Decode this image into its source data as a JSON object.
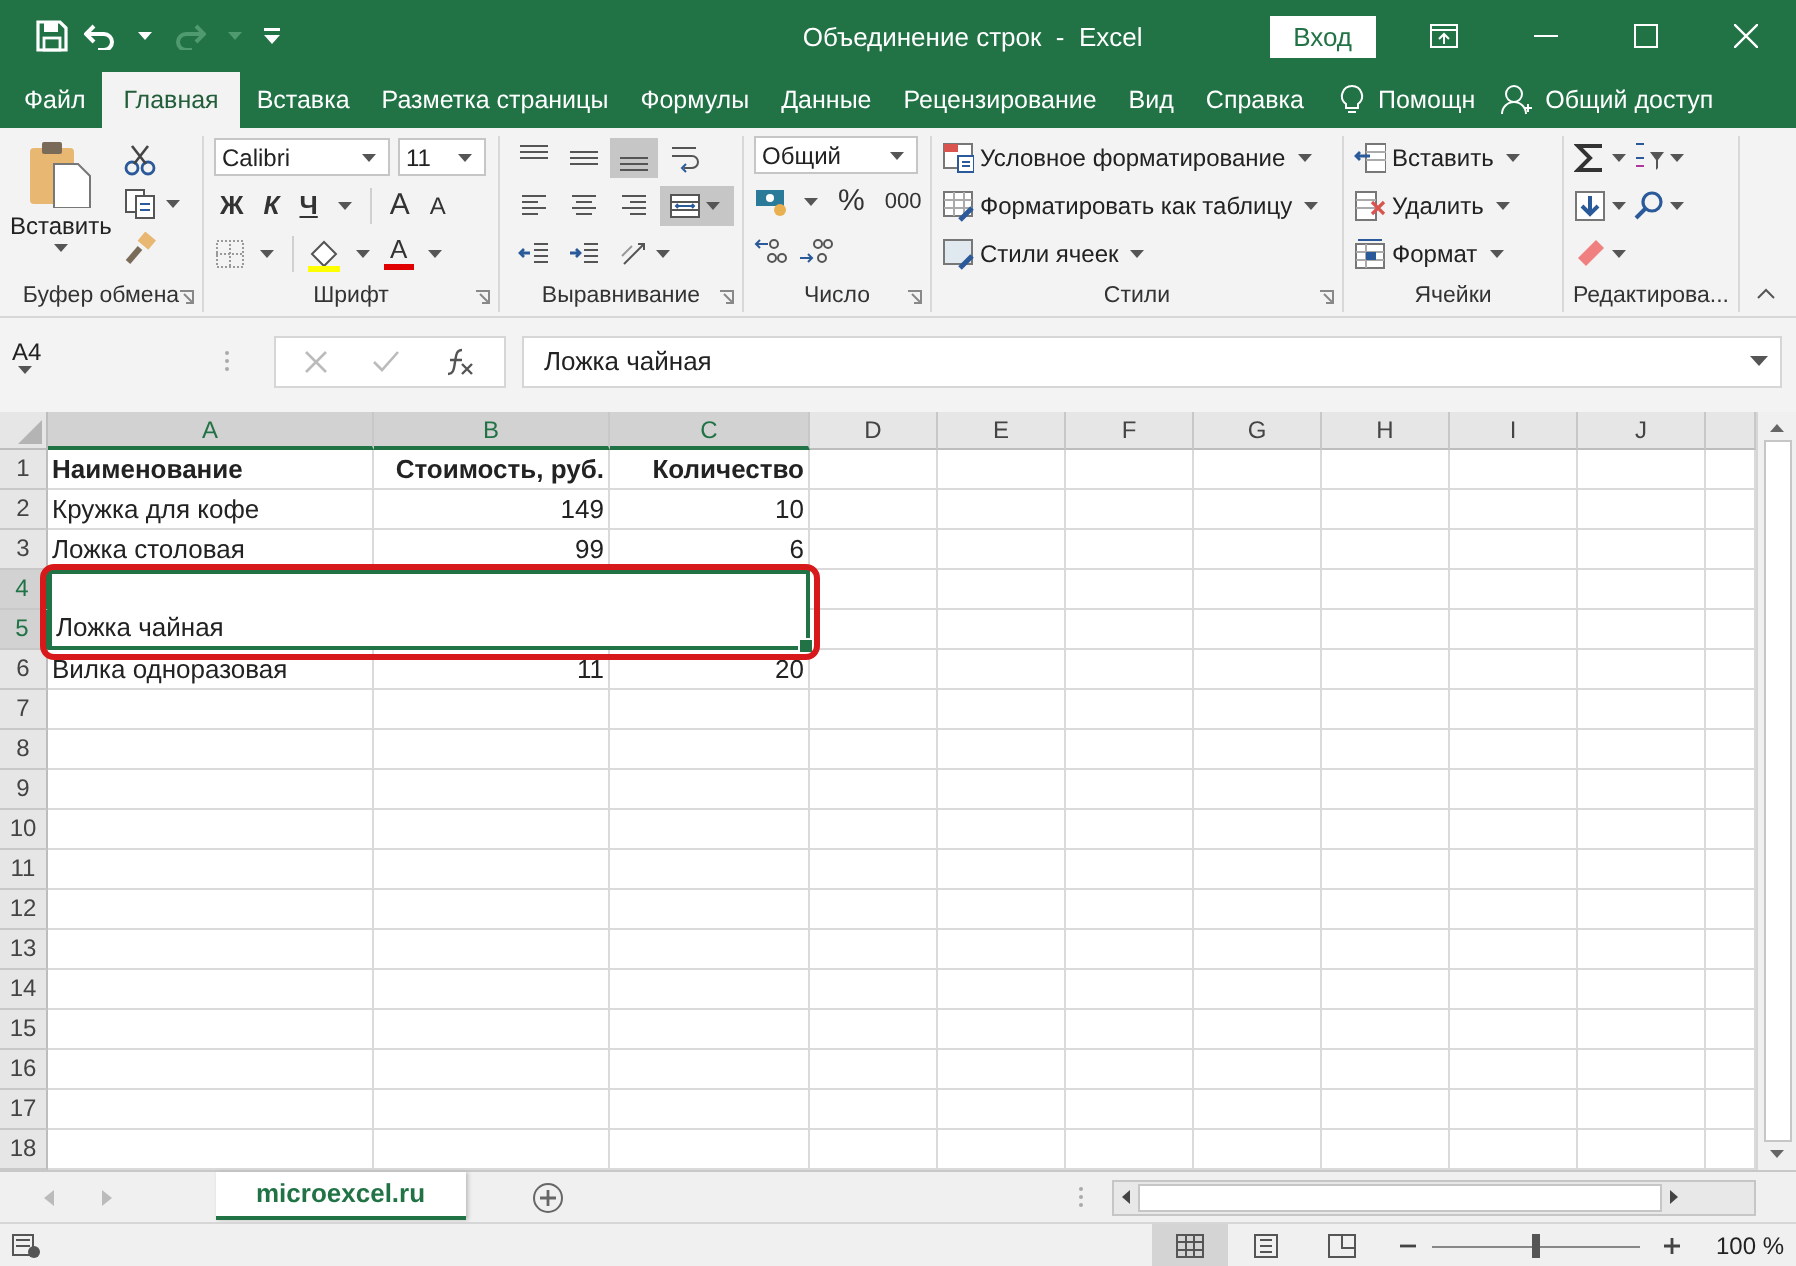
{
  "title_bar": {
    "title": "Объединение строк  -  Excel",
    "sign_in": "Вход"
  },
  "ribbon_tabs": [
    {
      "label": "Файл",
      "selected": false
    },
    {
      "label": "Главная",
      "selected": true
    },
    {
      "label": "Вставка",
      "selected": false
    },
    {
      "label": "Разметка страницы",
      "selected": false
    },
    {
      "label": "Формулы",
      "selected": false
    },
    {
      "label": "Данные",
      "selected": false
    },
    {
      "label": "Рецензирование",
      "selected": false
    },
    {
      "label": "Вид",
      "selected": false
    },
    {
      "label": "Справка",
      "selected": false
    }
  ],
  "tell_me": "Помощн",
  "share": "Общий доступ",
  "ribbon": {
    "clipboard": {
      "paste": "Вставить",
      "label": "Буфер обмена"
    },
    "font": {
      "name": "Calibri",
      "size": "11",
      "bold": "Ж",
      "italic": "К",
      "underline": "Ч",
      "grow": "A",
      "shrink": "A",
      "color_letter": "A",
      "label": "Шрифт"
    },
    "alignment": {
      "label": "Выравнивание",
      "buttons": [
        {
          "kind": "top",
          "selected": false
        },
        {
          "kind": "middle",
          "selected": false
        },
        {
          "kind": "bottom",
          "selected": true
        },
        {
          "kind": "wrap",
          "selected": false
        },
        {
          "kind": "left",
          "selected": false
        },
        {
          "kind": "center",
          "selected": false
        },
        {
          "kind": "right",
          "selected": false
        },
        {
          "kind": "merge",
          "selected": true
        },
        {
          "kind": "outdent",
          "selected": false
        },
        {
          "kind": "indent",
          "selected": false
        },
        {
          "kind": "orientation",
          "selected": false
        }
      ]
    },
    "number": {
      "format": "Общий",
      "percent": "%",
      "thousands": "000",
      "label": "Число"
    },
    "styles": {
      "label": "Стили",
      "commands": [
        {
          "kind": "conditional",
          "label": "Условное форматирование"
        },
        {
          "kind": "table",
          "label": "Форматировать как таблицу"
        },
        {
          "kind": "cell_styles",
          "label": "Стили ячеек"
        }
      ]
    },
    "cells": {
      "label": "Ячейки",
      "commands": [
        {
          "kind": "insert",
          "label": "Вставить"
        },
        {
          "kind": "delete",
          "label": "Удалить"
        },
        {
          "kind": "format",
          "label": "Формат"
        }
      ]
    },
    "editing": {
      "label": "Редактирова..."
    }
  },
  "formula_bar": {
    "name_box": "A4",
    "formula": "Ложка чайная"
  },
  "sheet": {
    "columns": [
      {
        "label": "A",
        "selected": true
      },
      {
        "label": "B",
        "selected": true
      },
      {
        "label": "C",
        "selected": true
      },
      {
        "label": "D",
        "selected": false
      },
      {
        "label": "E",
        "selected": false
      },
      {
        "label": "F",
        "selected": false
      },
      {
        "label": "G",
        "selected": false
      },
      {
        "label": "H",
        "selected": false
      },
      {
        "label": "I",
        "selected": false
      },
      {
        "label": "J",
        "selected": false
      }
    ],
    "rows": [
      {
        "number": "1",
        "selected": false,
        "kind": "data",
        "cells": [
          {
            "text": "Наименование",
            "kind": "heading"
          },
          {
            "text": "Стоимость, руб.",
            "kind": "heading_right"
          },
          {
            "text": "Количество",
            "kind": "heading_right"
          }
        ]
      },
      {
        "number": "2",
        "selected": false,
        "kind": "data",
        "cells": [
          {
            "text": "Кружка для кофе",
            "kind": "text"
          },
          {
            "text": "149",
            "kind": "number"
          },
          {
            "text": "10",
            "kind": "number"
          }
        ]
      },
      {
        "number": "3",
        "selected": false,
        "kind": "data",
        "cells": [
          {
            "text": "Ложка столовая",
            "kind": "text"
          },
          {
            "text": "99",
            "kind": "number"
          },
          {
            "text": "6",
            "kind": "number"
          }
        ]
      },
      {
        "number": "4",
        "selected": true,
        "kind": "merged",
        "highlighted": true,
        "text": "Ложка чайная"
      },
      {
        "number": "5",
        "selected": true,
        "kind": "covered"
      },
      {
        "number": "6",
        "selected": false,
        "kind": "data",
        "cells": [
          {
            "text": "Вилка одноразовая",
            "kind": "text"
          },
          {
            "text": "11",
            "kind": "number"
          },
          {
            "text": "20",
            "kind": "number"
          }
        ]
      },
      {
        "number": "7",
        "selected": false,
        "kind": "empty"
      },
      {
        "number": "8",
        "selected": false,
        "kind": "empty"
      },
      {
        "number": "9",
        "selected": false,
        "kind": "empty"
      },
      {
        "number": "10",
        "selected": false,
        "kind": "empty"
      },
      {
        "number": "11",
        "selected": false,
        "kind": "empty"
      },
      {
        "number": "12",
        "selected": false,
        "kind": "empty"
      },
      {
        "number": "13",
        "selected": false,
        "kind": "empty"
      },
      {
        "number": "14",
        "selected": false,
        "kind": "empty"
      },
      {
        "number": "15",
        "selected": false,
        "kind": "empty"
      },
      {
        "number": "16",
        "selected": false,
        "kind": "empty"
      },
      {
        "number": "17",
        "selected": false,
        "kind": "empty"
      },
      {
        "number": "18",
        "selected": false,
        "kind": "empty"
      }
    ]
  },
  "sheet_tabs": [
    {
      "label": "microexcel.ru",
      "selected": true
    }
  ],
  "status_bar": {
    "views": [
      {
        "kind": "normal",
        "selected": true
      },
      {
        "kind": "page_layout",
        "selected": false
      },
      {
        "kind": "page_break",
        "selected": false
      }
    ],
    "zoom": {
      "level": 0.5
    },
    "zoom_label": "100 %"
  }
}
